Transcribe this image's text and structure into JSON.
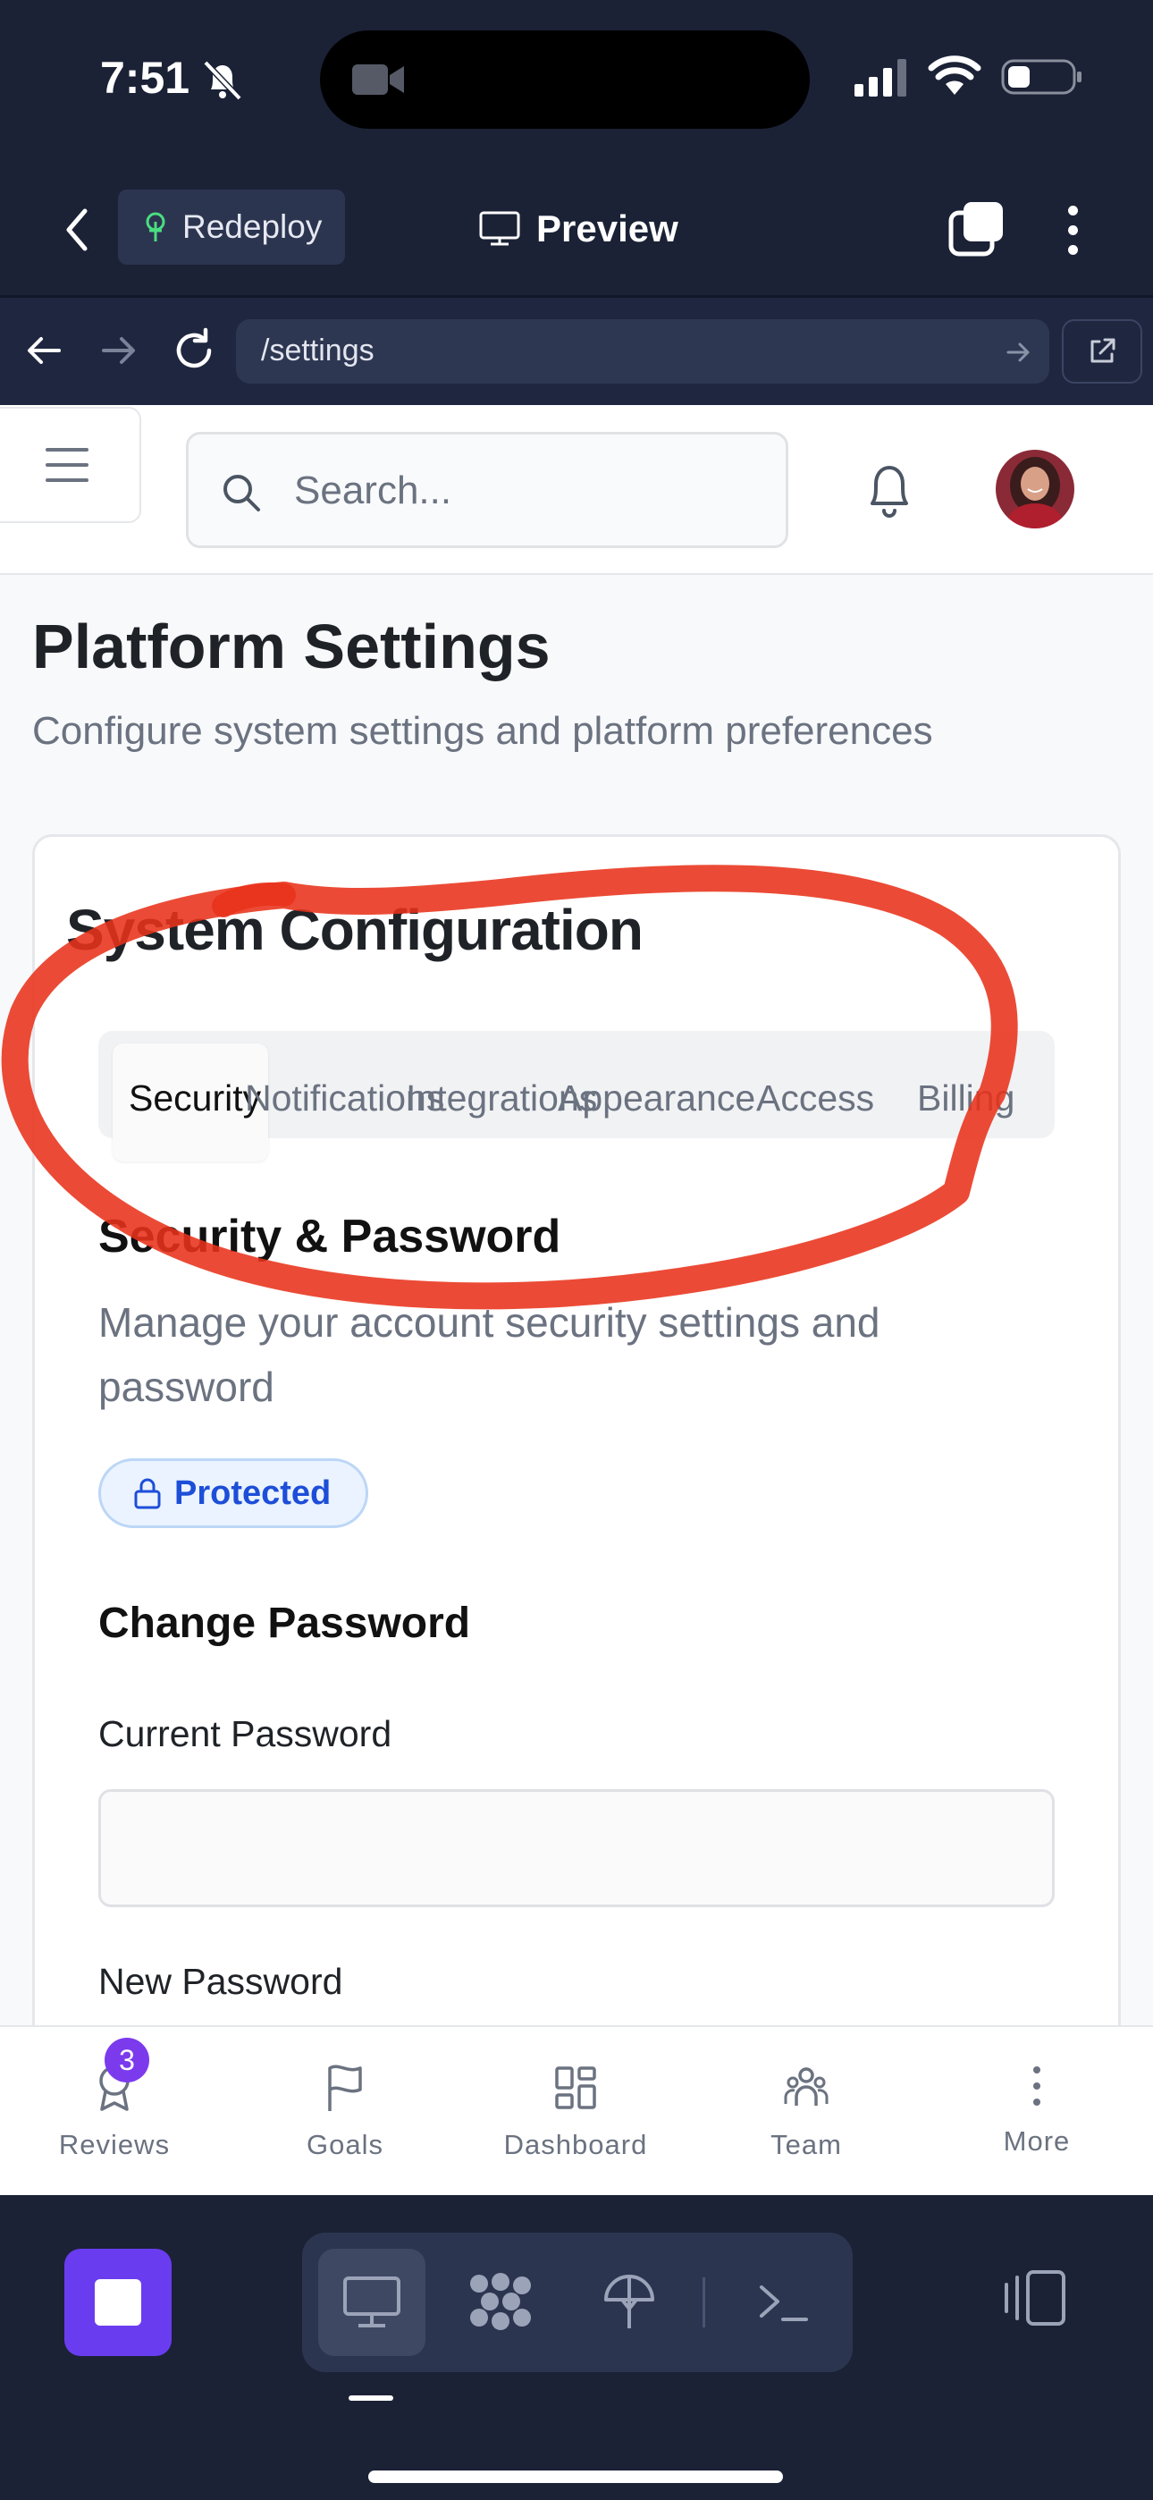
{
  "status_bar": {
    "time": "7:51"
  },
  "app_bar": {
    "redeploy_label": "Redeploy",
    "preview_label": "Preview"
  },
  "browser": {
    "url": "/settings"
  },
  "header": {
    "search_placeholder": "Search..."
  },
  "page": {
    "title": "Platform Settings",
    "subtitle": "Configure system settings and platform preferences"
  },
  "card": {
    "title": "System Configuration",
    "tabs": [
      {
        "label": "Security",
        "active": true
      },
      {
        "label": "Notifications",
        "active": false
      },
      {
        "label": "Integrations",
        "active": false
      },
      {
        "label": "Appearance",
        "active": false
      },
      {
        "label": "Access",
        "active": false
      },
      {
        "label": "Billing",
        "active": false
      }
    ],
    "section_title": "Security & Password",
    "section_description": "Manage your account security settings and password",
    "badge_label": "Protected",
    "subsection_title": "Change Password",
    "fields": [
      {
        "label": "Current Password",
        "value": ""
      },
      {
        "label": "New Password",
        "value": ""
      }
    ]
  },
  "bottom_nav": {
    "items": [
      {
        "label": "Reviews",
        "icon": "award-icon",
        "badge": "3"
      },
      {
        "label": "Goals",
        "icon": "flag-icon"
      },
      {
        "label": "Dashboard",
        "icon": "dashboard-icon"
      },
      {
        "label": "Team",
        "icon": "team-icon"
      },
      {
        "label": "More",
        "icon": "more-vertical-icon"
      }
    ]
  },
  "colors": {
    "chrome_bg": "#1b2236",
    "accent_purple": "#6a3cf0",
    "badge_blue": "#1d4ed8",
    "annotation_red": "#e8321a"
  }
}
